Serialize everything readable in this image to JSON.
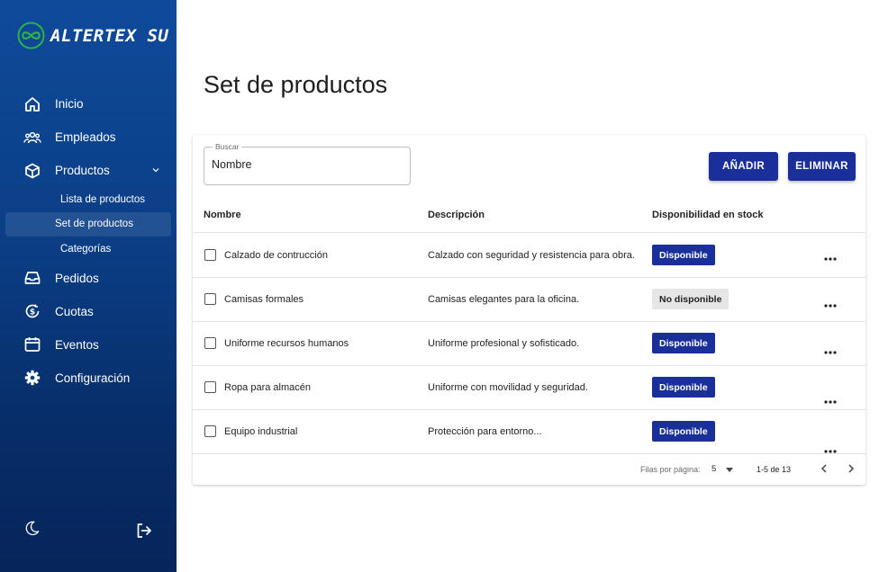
{
  "brand": {
    "name": "ALTERTEX SU",
    "accent": "#1a2f9a",
    "logo_ring": "#2fb44a"
  },
  "sidebar": {
    "items": [
      {
        "id": "inicio",
        "label": "Inicio",
        "icon": "home-icon"
      },
      {
        "id": "empleados",
        "label": "Empleados",
        "icon": "people-icon"
      },
      {
        "id": "productos",
        "label": "Productos",
        "icon": "box-icon",
        "expanded": true,
        "children": [
          {
            "label": "Lista de productos"
          },
          {
            "label": "Set de productos",
            "active": true
          },
          {
            "label": "Categorías"
          }
        ]
      },
      {
        "id": "pedidos",
        "label": "Pedidos",
        "icon": "inbox-icon"
      },
      {
        "id": "cuotas",
        "label": "Cuotas",
        "icon": "dollar-icon"
      },
      {
        "id": "eventos",
        "label": "Eventos",
        "icon": "calendar-icon"
      },
      {
        "id": "configuracion",
        "label": "Configuración",
        "icon": "gear-icon"
      }
    ],
    "theme_icon": "moon-icon",
    "logout_icon": "logout-icon"
  },
  "page": {
    "title": "Set de productos"
  },
  "search": {
    "label": "Buscar",
    "value": "Nombre"
  },
  "toolbar": {
    "add_label": "AÑADIR",
    "delete_label": "ELIMINAR"
  },
  "table": {
    "columns": [
      "Nombre",
      "Descripción",
      "Disponibilidad en stock"
    ],
    "rows": [
      {
        "name": "Calzado de contrucción",
        "description": "Calzado con seguridad y resistencia para obra.",
        "status": "Disponible",
        "available": true
      },
      {
        "name": "Camisas formales",
        "description": "Camisas elegantes para la oficina.",
        "status": "No disponible",
        "available": false
      },
      {
        "name": "Uniforme recursos humanos",
        "description": "Uniforme profesional y sofisticado.",
        "status": "Disponible",
        "available": true
      },
      {
        "name": "Ropa para almacén",
        "description": "Uniforme con movilidad y seguridad.",
        "status": "Disponible",
        "available": true
      },
      {
        "name": "Equipo industrial",
        "description": "Protección para entorno...",
        "status": "Disponible",
        "available": true
      }
    ]
  },
  "pagination": {
    "rows_per_page_label": "Filas por página:",
    "rows_per_page": "5",
    "range": "1-5 de 13"
  }
}
